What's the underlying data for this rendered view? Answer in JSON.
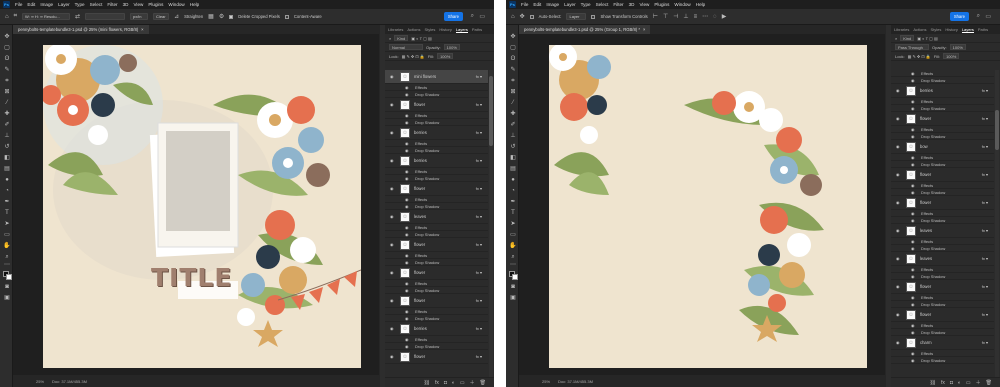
{
  "menu": [
    "File",
    "Edit",
    "Image",
    "Layer",
    "Type",
    "Select",
    "Filter",
    "3D",
    "View",
    "Plugins",
    "Window",
    "Help"
  ],
  "app_icon": "Ps",
  "share_label": "Share",
  "panel_tabs": [
    "Libraries",
    "Actions",
    "Styles",
    "History",
    "Layers",
    "Paths"
  ],
  "colors": {
    "accent": "#1473e6",
    "canvas_bg": "#efe4cf",
    "flower_red": "#e5704f",
    "leaf_green": "#8aa25a",
    "flower_blue": "#8fb4cc",
    "tan": "#d9a863",
    "navy": "#2b3b4a"
  },
  "left": {
    "options": {
      "size_field": "W: ∞ H: ∞ Resolu...",
      "unit_field": "px/in",
      "clear_label": "Clear",
      "straighten_label": "Straighten",
      "delete_cropped": "Delete Cropped Pixels",
      "content_aware": "Content-Aware"
    },
    "doc_tab": "pennybolts-templatebundle3-1.psd @ 25% (mini flowers, RGB/8)",
    "filter_kind": "Kind",
    "blend_mode": "Normal",
    "opacity_label": "Opacity:",
    "opacity_value": "100%",
    "lock_label": "Lock:",
    "fill_label": "Fill:",
    "fill_value": "100%",
    "zoom": "25%",
    "doc_info": "Doc: 37.1M/455.3M",
    "title_text": "TITLE",
    "layers": [
      {
        "kind": "layer",
        "name": "mini flowers",
        "selected": true,
        "fx": true
      },
      {
        "kind": "effects",
        "name": "Effects"
      },
      {
        "kind": "effect",
        "name": "Drop Shadow"
      },
      {
        "kind": "layer",
        "name": "flower",
        "fx": true
      },
      {
        "kind": "effects",
        "name": "Effects"
      },
      {
        "kind": "effect",
        "name": "Drop Shadow"
      },
      {
        "kind": "layer",
        "name": "berries",
        "fx": true
      },
      {
        "kind": "effects",
        "name": "Effects"
      },
      {
        "kind": "effect",
        "name": "Drop Shadow"
      },
      {
        "kind": "layer",
        "name": "berries",
        "fx": true
      },
      {
        "kind": "effects",
        "name": "Effects"
      },
      {
        "kind": "effect",
        "name": "Drop Shadow"
      },
      {
        "kind": "layer",
        "name": "flower",
        "fx": true
      },
      {
        "kind": "effects",
        "name": "Effects"
      },
      {
        "kind": "effect",
        "name": "Drop Shadow"
      },
      {
        "kind": "layer",
        "name": "leaves",
        "fx": true
      },
      {
        "kind": "effects",
        "name": "Effects"
      },
      {
        "kind": "effect",
        "name": "Drop Shadow"
      },
      {
        "kind": "layer",
        "name": "flower",
        "fx": true
      },
      {
        "kind": "effects",
        "name": "Effects"
      },
      {
        "kind": "effect",
        "name": "Drop Shadow"
      },
      {
        "kind": "layer",
        "name": "flower",
        "fx": true
      },
      {
        "kind": "effects",
        "name": "Effects"
      },
      {
        "kind": "effect",
        "name": "Drop Shadow"
      },
      {
        "kind": "layer",
        "name": "flower",
        "fx": true
      },
      {
        "kind": "effects",
        "name": "Effects"
      },
      {
        "kind": "effect",
        "name": "Drop Shadow"
      },
      {
        "kind": "layer",
        "name": "berries",
        "fx": true
      },
      {
        "kind": "effects",
        "name": "Effects"
      },
      {
        "kind": "effect",
        "name": "Drop Shadow"
      },
      {
        "kind": "layer",
        "name": "flower",
        "fx": true
      }
    ]
  },
  "right": {
    "options": {
      "auto_select": "Auto-Select:",
      "target": "Layer",
      "transform": "Show Transform Controls"
    },
    "doc_tab": "pennybolts-templatebundle3-1.psd @ 25% (Group 1, RGB/8) *",
    "filter_kind": "Kind",
    "blend_mode": "Pass Through",
    "opacity_label": "Opacity:",
    "opacity_value": "100%",
    "lock_label": "Lock:",
    "fill_label": "Fill:",
    "fill_value": "100%",
    "zoom": "25%",
    "doc_info": "Doc: 37.1M/455.3M",
    "layers": [
      {
        "kind": "effects",
        "name": "Effects"
      },
      {
        "kind": "effect",
        "name": "Drop Shadow"
      },
      {
        "kind": "layer",
        "name": "berries",
        "fx": true
      },
      {
        "kind": "effects",
        "name": "Effects"
      },
      {
        "kind": "effect",
        "name": "Drop Shadow"
      },
      {
        "kind": "layer",
        "name": "flower",
        "fx": true
      },
      {
        "kind": "effects",
        "name": "Effects"
      },
      {
        "kind": "effect",
        "name": "Drop Shadow"
      },
      {
        "kind": "layer",
        "name": "bow",
        "fx": true
      },
      {
        "kind": "effects",
        "name": "Effects"
      },
      {
        "kind": "effect",
        "name": "Drop Shadow"
      },
      {
        "kind": "layer",
        "name": "flower",
        "fx": true
      },
      {
        "kind": "effects",
        "name": "Effects"
      },
      {
        "kind": "effect",
        "name": "Drop Shadow"
      },
      {
        "kind": "layer",
        "name": "flower",
        "fx": true
      },
      {
        "kind": "effects",
        "name": "Effects"
      },
      {
        "kind": "effect",
        "name": "Drop Shadow"
      },
      {
        "kind": "layer",
        "name": "leaves",
        "fx": true
      },
      {
        "kind": "effects",
        "name": "Effects"
      },
      {
        "kind": "effect",
        "name": "Drop Shadow"
      },
      {
        "kind": "layer",
        "name": "leaves",
        "fx": true
      },
      {
        "kind": "effects",
        "name": "Effects"
      },
      {
        "kind": "effect",
        "name": "Drop Shadow"
      },
      {
        "kind": "layer",
        "name": "flower",
        "fx": true
      },
      {
        "kind": "effects",
        "name": "Effects"
      },
      {
        "kind": "effect",
        "name": "Drop Shadow"
      },
      {
        "kind": "layer",
        "name": "flower",
        "fx": true
      },
      {
        "kind": "effects",
        "name": "Effects"
      },
      {
        "kind": "effect",
        "name": "Drop Shadow"
      },
      {
        "kind": "layer",
        "name": "charm",
        "fx": true
      },
      {
        "kind": "effects",
        "name": "Effects"
      },
      {
        "kind": "effect",
        "name": "Drop Shadow"
      }
    ]
  }
}
